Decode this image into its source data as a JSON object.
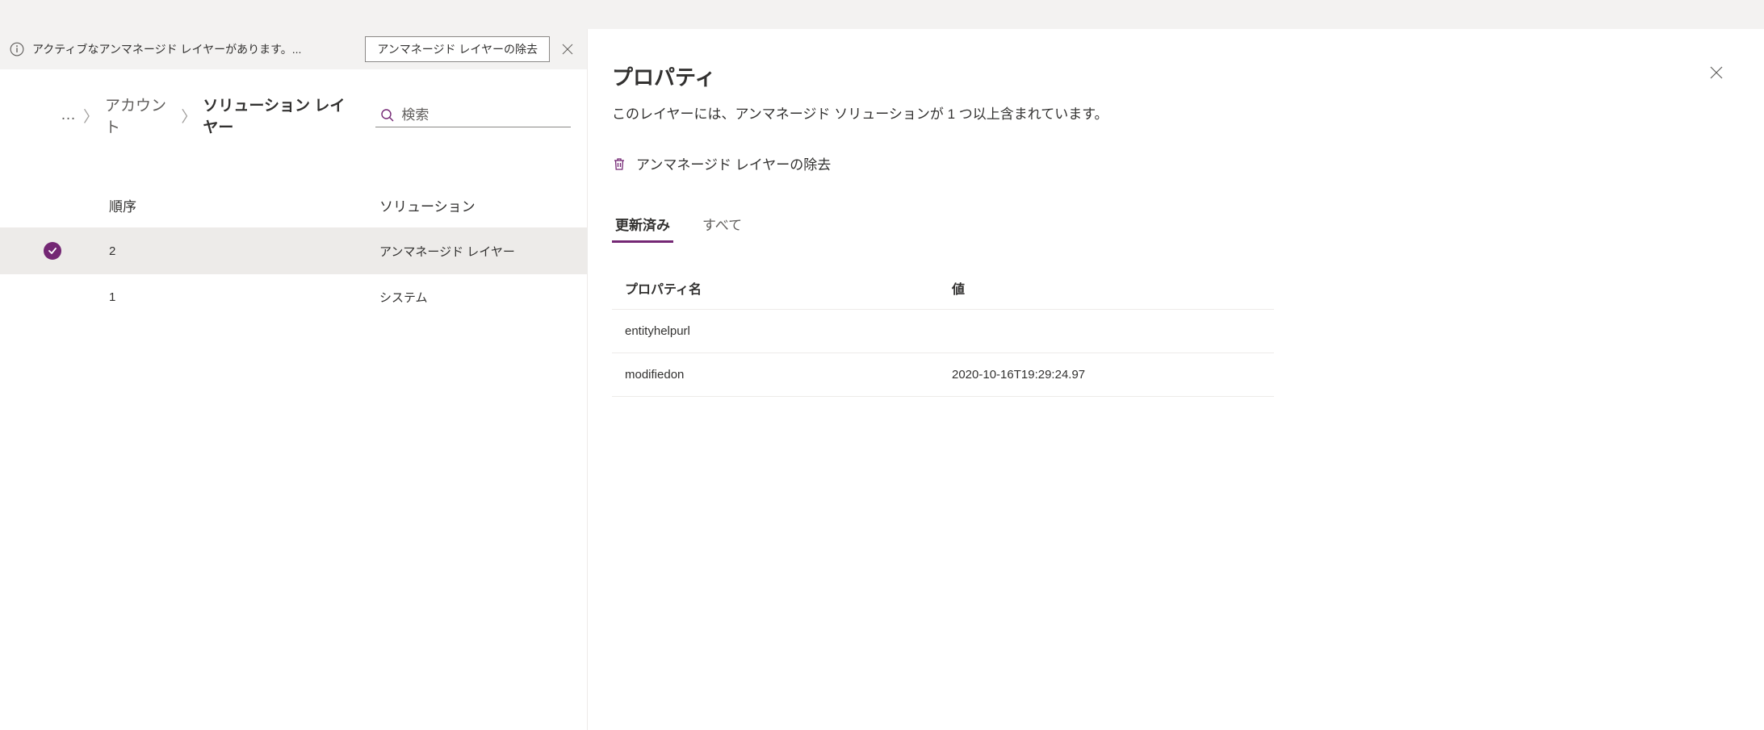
{
  "notification": {
    "text": "アクティブなアンマネージド レイヤーがあります。...",
    "button_label": "アンマネージド レイヤーの除去"
  },
  "breadcrumb": {
    "ellipsis": "…",
    "account": "アカウント",
    "current": "ソリューション レイヤー"
  },
  "search": {
    "placeholder": "検索"
  },
  "layers_table": {
    "headers": {
      "order": "順序",
      "solution": "ソリューション"
    },
    "rows": [
      {
        "order": "2",
        "solution": "アンマネージド レイヤー",
        "selected": true
      },
      {
        "order": "1",
        "solution": "システム",
        "selected": false
      }
    ]
  },
  "panel": {
    "title": "プロパティ",
    "description": "このレイヤーには、アンマネージド ソリューションが 1 つ以上含まれています。",
    "action_label": "アンマネージド レイヤーの除去",
    "tabs": {
      "updated": "更新済み",
      "all": "すべて"
    },
    "property_table": {
      "headers": {
        "name": "プロパティ名",
        "value": "値"
      },
      "rows": [
        {
          "name": "entityhelpurl",
          "value": ""
        },
        {
          "name": "modifiedon",
          "value": "2020-10-16T19:29:24.97"
        }
      ]
    }
  }
}
